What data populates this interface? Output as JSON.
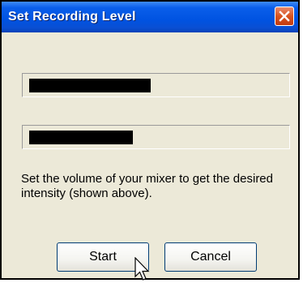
{
  "window": {
    "title": "Set Recording Level",
    "close_icon": "close-icon"
  },
  "meters": [
    {
      "level_fraction": 0.48
    },
    {
      "level_fraction": 0.41
    }
  ],
  "instructions": "Set the volume of your mixer to get the desired intensity (shown above).",
  "buttons": {
    "start_label": "Start",
    "cancel_label": "Cancel"
  },
  "colors": {
    "title_bar": "#0053E1",
    "dialog_bg": "#ECE9D8",
    "meter_fill": "#000000",
    "close_button": "#D8541F"
  }
}
